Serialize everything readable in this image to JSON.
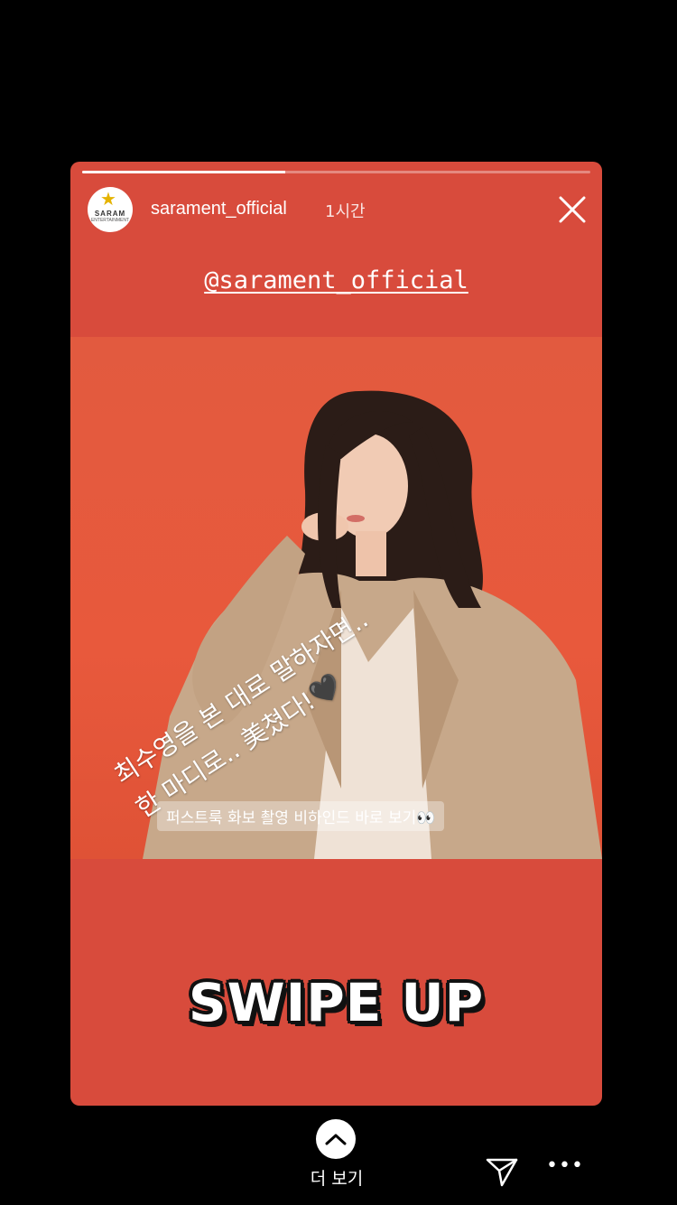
{
  "story": {
    "progress": 0.4,
    "username": "sarament_official",
    "timestamp": "1시간",
    "avatar_text": "SARAM",
    "avatar_sub": "ENTERTAINMENT",
    "mention": "@sarament_official",
    "overlay_line1": "최수영을 본 대로 말하자면..",
    "overlay_line2": "한 마디로.. 美쳤다!",
    "overlay_emoji": "🖤",
    "caption_chip": "퍼스트룩 화보 촬영 비하인드 바로 보기👀",
    "swipe_text": "SWIPE UP",
    "background_color": "#d84b3c"
  },
  "bottom": {
    "see_more_label": "더 보기",
    "more_dots": "•••"
  },
  "icons": {
    "close": "close-icon",
    "chevron": "chevron-up-icon",
    "share": "paper-plane-icon",
    "more": "more-dots-icon"
  }
}
